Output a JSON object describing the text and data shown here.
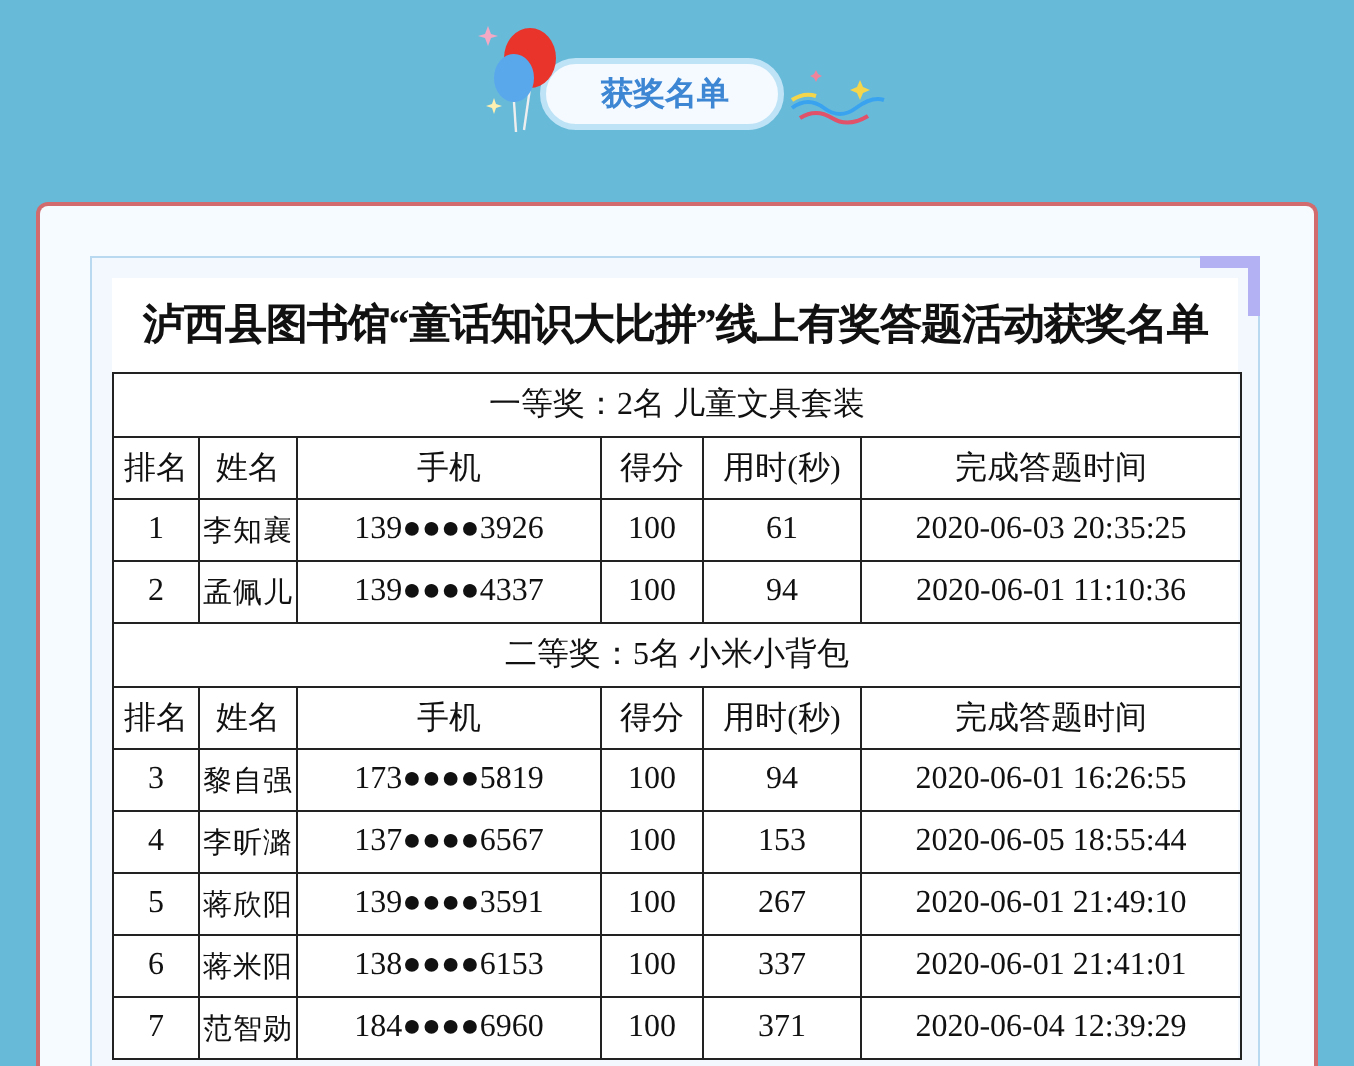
{
  "banner": {
    "title": "获奖名单"
  },
  "document": {
    "title": "泸西县图书馆“童话知识大比拼”线上有奖答题活动获奖名单",
    "sections": [
      {
        "prize": "一等奖：2名 儿童文具套装",
        "columns": [
          "排名",
          "姓名",
          "手机",
          "得分",
          "用时(秒)",
          "完成答题时间"
        ],
        "rows": [
          [
            "1",
            "李知襄",
            "139●●●●3926",
            "100",
            "61",
            "2020-06-03 20:35:25"
          ],
          [
            "2",
            "孟佩儿",
            "139●●●●4337",
            "100",
            "94",
            "2020-06-01 11:10:36"
          ]
        ]
      },
      {
        "prize": "二等奖：5名 小米小背包",
        "columns": [
          "排名",
          "姓名",
          "手机",
          "得分",
          "用时(秒)",
          "完成答题时间"
        ],
        "rows": [
          [
            "3",
            "黎自强",
            "173●●●●5819",
            "100",
            "94",
            "2020-06-01 16:26:55"
          ],
          [
            "4",
            "李昕潞",
            "137●●●●6567",
            "100",
            "153",
            "2020-06-05 18:55:44"
          ],
          [
            "5",
            "蒋欣阳",
            "139●●●●3591",
            "100",
            "267",
            "2020-06-01 21:49:10"
          ],
          [
            "6",
            "蒋米阳",
            "138●●●●6153",
            "100",
            "337",
            "2020-06-01 21:41:01"
          ],
          [
            "7",
            "范智勋",
            "184●●●●6960",
            "100",
            "371",
            "2020-06-04 12:39:29"
          ]
        ]
      }
    ]
  }
}
